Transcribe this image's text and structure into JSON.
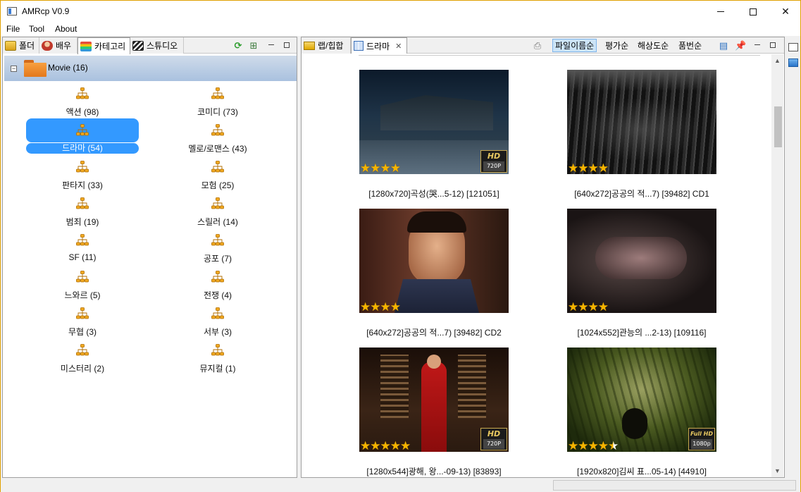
{
  "window": {
    "title": "AMRcp V0.9"
  },
  "menu": [
    "File",
    "Tool",
    "About"
  ],
  "left_tabs": [
    {
      "label": "폴더",
      "icon": "folder-tab-icon"
    },
    {
      "label": "배우",
      "icon": "actor-tab-icon"
    },
    {
      "label": "카테고리",
      "icon": "category-tab-icon"
    },
    {
      "label": "스튜디오",
      "icon": "studio-tab-icon"
    }
  ],
  "tree": {
    "root_label": "Movie (16)",
    "categories": [
      {
        "label": "액션 (98)"
      },
      {
        "label": "코미디 (73)"
      },
      {
        "label": "드라마 (54)",
        "selected": true
      },
      {
        "label": "멜로/로맨스 (43)"
      },
      {
        "label": "판타지 (33)"
      },
      {
        "label": "모험 (25)"
      },
      {
        "label": "범죄 (19)"
      },
      {
        "label": "스릴러 (14)"
      },
      {
        "label": "SF (11)"
      },
      {
        "label": "공포 (7)"
      },
      {
        "label": "느와르 (5)"
      },
      {
        "label": "전쟁 (4)"
      },
      {
        "label": "무협 (3)"
      },
      {
        "label": "서부 (3)"
      },
      {
        "label": "미스터리 (2)"
      },
      {
        "label": "뮤지컬 (1)"
      }
    ]
  },
  "right_tabs": [
    {
      "label": "랩/힙합"
    },
    {
      "label": "드라마",
      "active": true,
      "closable": true
    }
  ],
  "sort_buttons": [
    {
      "label": "파일이름순",
      "active": true
    },
    {
      "label": "평가순"
    },
    {
      "label": "해상도순"
    },
    {
      "label": "품번순"
    }
  ],
  "thumbnails": [
    {
      "caption": "[1280x720]곡성(哭...5-12) [121051]",
      "rating": 4,
      "badge": {
        "top": "HD",
        "bottom": "720P"
      },
      "scene": "night-village"
    },
    {
      "caption": "[640x272]공공의 적...7) [39482] CD1",
      "rating": 4,
      "badge": null,
      "scene": "crowd-night"
    },
    {
      "caption": "[640x272]공공의 적...7) [39482] CD2",
      "rating": 4,
      "badge": null,
      "scene": "portrait"
    },
    {
      "caption": "[1024x552]관능의 ...2-13) [109116]",
      "rating": 4,
      "badge": null,
      "scene": "dark-car"
    },
    {
      "caption": "[1280x544]광해, 왕...-09-13) [83893]",
      "rating": 5,
      "badge": {
        "top": "HD",
        "bottom": "720P"
      },
      "scene": "palace-red"
    },
    {
      "caption": "[1920x820]김씨 표...05-14) [44910]",
      "rating": 4.5,
      "badge": {
        "top": "Full HD",
        "bottom": "1080p"
      },
      "scene": "forest"
    }
  ],
  "colors": {
    "selection": "#3399ff",
    "tree_root_bg": "#a9c1df",
    "star": "#f5b400",
    "window_border": "#e0a000"
  }
}
